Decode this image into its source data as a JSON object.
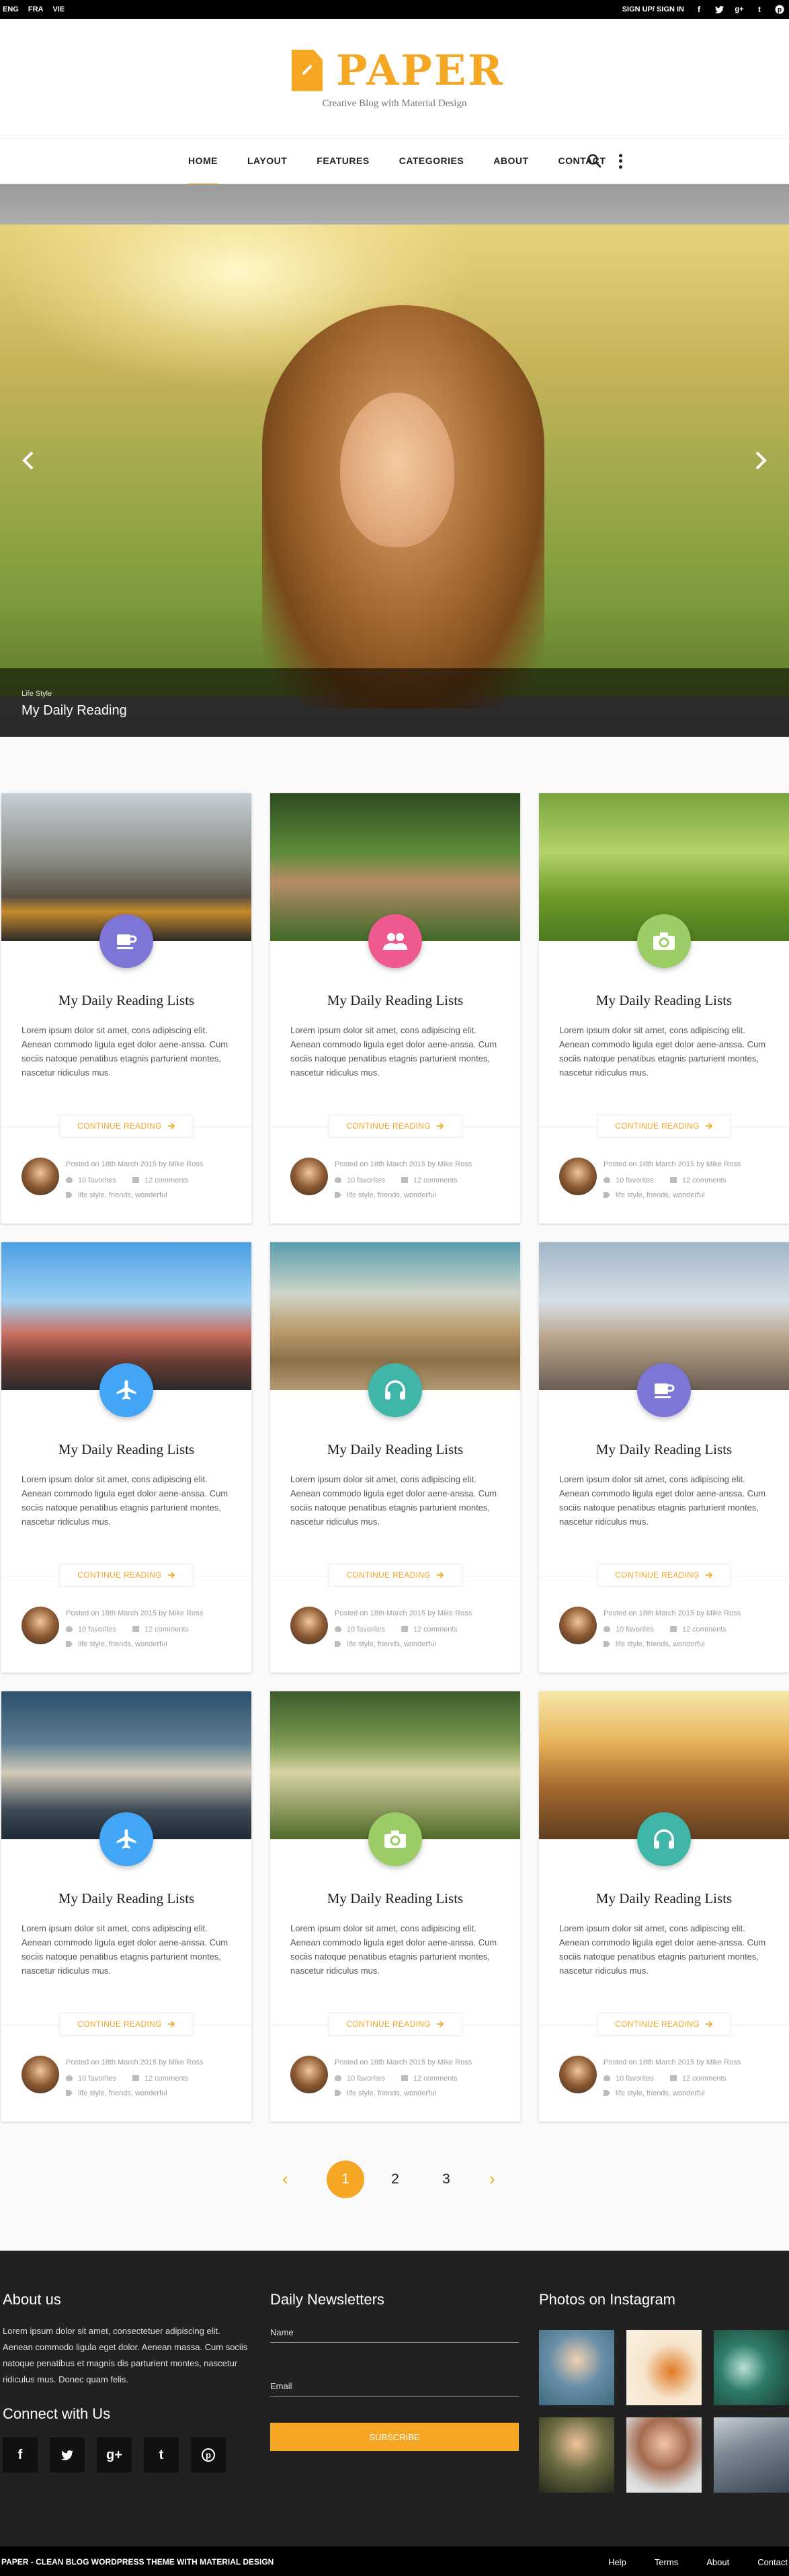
{
  "topbar": {
    "languages": [
      "ENG",
      "FRA",
      "VIE"
    ],
    "sign_label": "SIGN UP/ SIGN IN",
    "social": [
      "facebook-icon",
      "twitter-icon",
      "google-plus-icon",
      "tumblr-icon",
      "pinterest-icon"
    ]
  },
  "header": {
    "logo_text": "PAPER",
    "tagline": "Creative Blog with Material Design"
  },
  "nav": {
    "items": [
      "HOME",
      "LAYOUT",
      "FEATURES",
      "CATEGORIES",
      "ABOUT",
      "CONTACT"
    ],
    "active_index": 0
  },
  "slider": {
    "category": "Life Style",
    "title": "My Daily Reading"
  },
  "colors": {
    "accent": "#f5a623",
    "purple": "#7e76d6",
    "pink": "#ee5a8f",
    "green": "#9ccc65",
    "blue": "#42a5f5",
    "teal": "#3fb6a8"
  },
  "posts": [
    {
      "title": "My Daily Reading Lists",
      "excerpt": "Lorem ipsum dolor sit amet, cons adipiscing elit. Aenean commodo ligula eget dolor aene-anssa. Cum sociis natoque penatibus etagnis parturient montes, nascetur ridiculus mus.",
      "button": "CONTINUE READING",
      "posted": "Posted on 18th March 2015 by Mike Ross",
      "favorites": "10 favorites",
      "comments": "12 comments",
      "tags": "life style, friends, wonderful",
      "icon": "coffee-icon",
      "icon_color": "#7e76d6"
    },
    {
      "title": "My Daily Reading Lists",
      "excerpt": "Lorem ipsum dolor sit amet, cons adipiscing elit. Aenean commodo ligula eget dolor aene-anssa. Cum sociis natoque penatibus etagnis parturient montes, nascetur ridiculus mus.",
      "button": "CONTINUE READING",
      "posted": "Posted on 18th March 2015 by Mike Ross",
      "favorites": "10 favorites",
      "comments": "12 comments",
      "tags": "life style, friends, wonderful",
      "icon": "people-icon",
      "icon_color": "#ee5a8f"
    },
    {
      "title": "My Daily Reading Lists",
      "excerpt": "Lorem ipsum dolor sit amet, cons adipiscing elit. Aenean commodo ligula eget dolor aene-anssa. Cum sociis natoque penatibus etagnis parturient montes, nascetur ridiculus mus.",
      "button": "CONTINUE READING",
      "posted": "Posted on 18th March 2015 by Mike Ross",
      "favorites": "10 favorites",
      "comments": "12 comments",
      "tags": "life style, friends, wonderful",
      "icon": "camera-icon",
      "icon_color": "#9ccc65"
    },
    {
      "title": "My Daily Reading Lists",
      "excerpt": "Lorem ipsum dolor sit amet, cons adipiscing elit. Aenean commodo ligula eget dolor aene-anssa. Cum sociis natoque penatibus etagnis parturient montes, nascetur ridiculus mus.",
      "button": "CONTINUE READING",
      "posted": "Posted on 18th March 2015 by Mike Ross",
      "favorites": "10 favorites",
      "comments": "12 comments",
      "tags": "life style, friends, wonderful",
      "icon": "airplane-icon",
      "icon_color": "#42a5f5"
    },
    {
      "title": "My Daily Reading Lists",
      "excerpt": "Lorem ipsum dolor sit amet, cons adipiscing elit. Aenean commodo ligula eget dolor aene-anssa. Cum sociis natoque penatibus etagnis parturient montes, nascetur ridiculus mus.",
      "button": "CONTINUE READING",
      "posted": "Posted on 18th March 2015 by Mike Ross",
      "favorites": "10 favorites",
      "comments": "12 comments",
      "tags": "life style, friends, wonderful",
      "icon": "headphones-icon",
      "icon_color": "#3fb6a8"
    },
    {
      "title": "My Daily Reading Lists",
      "excerpt": "Lorem ipsum dolor sit amet, cons adipiscing elit. Aenean commodo ligula eget dolor aene-anssa. Cum sociis natoque penatibus etagnis parturient montes, nascetur ridiculus mus.",
      "button": "CONTINUE READING",
      "posted": "Posted on 18th March 2015 by Mike Ross",
      "favorites": "10 favorites",
      "comments": "12 comments",
      "tags": "life style, friends, wonderful",
      "icon": "coffee-icon",
      "icon_color": "#7e76d6"
    },
    {
      "title": "My Daily Reading Lists",
      "excerpt": "Lorem ipsum dolor sit amet, cons adipiscing elit. Aenean commodo ligula eget dolor aene-anssa. Cum sociis natoque penatibus etagnis parturient montes, nascetur ridiculus mus.",
      "button": "CONTINUE READING",
      "posted": "Posted on 18th March 2015 by Mike Ross",
      "favorites": "10 favorites",
      "comments": "12 comments",
      "tags": "life style, friends, wonderful",
      "icon": "airplane-icon",
      "icon_color": "#42a5f5"
    },
    {
      "title": "My Daily Reading Lists",
      "excerpt": "Lorem ipsum dolor sit amet, cons adipiscing elit. Aenean commodo ligula eget dolor aene-anssa. Cum sociis natoque penatibus etagnis parturient montes, nascetur ridiculus mus.",
      "button": "CONTINUE READING",
      "posted": "Posted on 18th March 2015 by Mike Ross",
      "favorites": "10 favorites",
      "comments": "12 comments",
      "tags": "life style, friends, wonderful",
      "icon": "camera-icon",
      "icon_color": "#9ccc65"
    },
    {
      "title": "My Daily Reading Lists",
      "excerpt": "Lorem ipsum dolor sit amet, cons adipiscing elit. Aenean commodo ligula eget dolor aene-anssa. Cum sociis natoque penatibus etagnis parturient montes, nascetur ridiculus mus.",
      "button": "CONTINUE READING",
      "posted": "Posted on 18th March 2015 by Mike Ross",
      "favorites": "10 favorites",
      "comments": "12 comments",
      "tags": "life style, friends, wonderful",
      "icon": "headphones-icon",
      "icon_color": "#3fb6a8"
    }
  ],
  "pagination": {
    "pages": [
      "1",
      "2",
      "3"
    ],
    "current": 1,
    "prev": "‹",
    "next": "›"
  },
  "footer": {
    "about_title": "About us",
    "about_text": "Lorem ipsum dolor sit amet, consectetuer adipiscing elit. Aenean commodo ligula eget dolor. Aenean massa. Cum sociis natoque penatibus et magnis dis parturient montes, nascetur ridiculus mus. Donec quam felis.",
    "connect_title": "Connect with Us",
    "social": [
      {
        "icon": "facebook-icon",
        "glyph": "f"
      },
      {
        "icon": "twitter-icon",
        "glyph": "t"
      },
      {
        "icon": "google-plus-icon",
        "glyph": "g+"
      },
      {
        "icon": "tumblr-icon",
        "glyph": "t"
      },
      {
        "icon": "pinterest-icon",
        "glyph": "p"
      }
    ],
    "newsletter_title": "Daily Newsletters",
    "name_label": "Name",
    "email_label": "Email",
    "subscribe_label": "SUBSCRIBE",
    "instagram_title": "Photos on Instagram"
  },
  "bottombar": {
    "copyright": "PAPER - CLEAN BLOG WORDPRESS THEME WITH MATERIAL DESIGN",
    "links": [
      "Help",
      "Terms",
      "About",
      "Contact"
    ]
  }
}
